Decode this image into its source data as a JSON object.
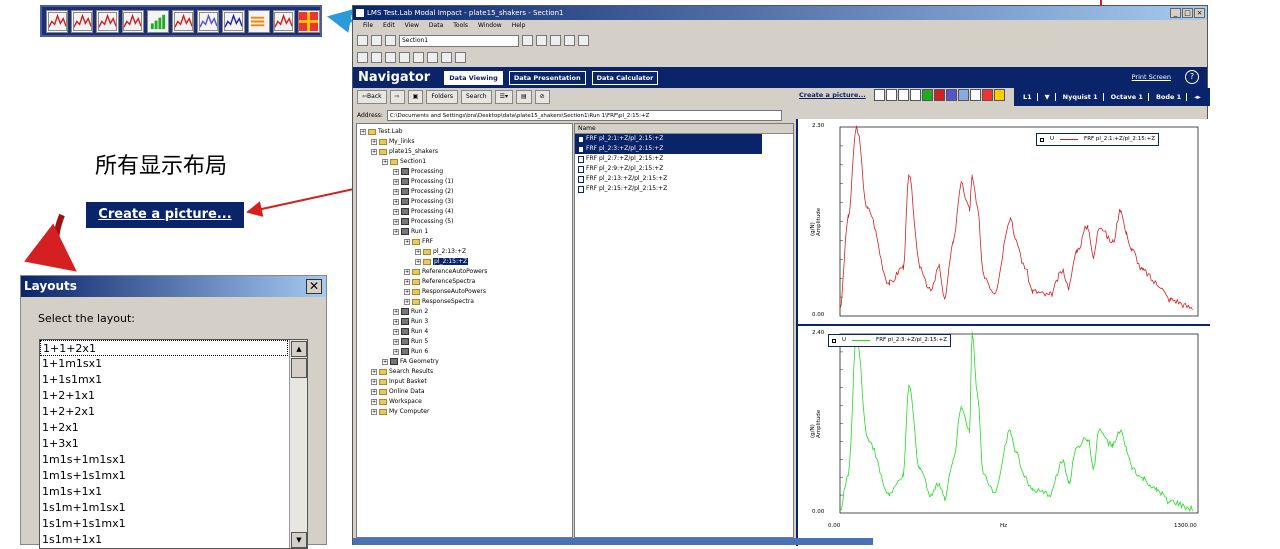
{
  "annotations": {
    "chinese_heading": "所有显示布局",
    "create_picture_big": "Create a picture..."
  },
  "toolbar_icons": [
    "spectrum-icon",
    "frf-icon",
    "overlay-icon",
    "nyquist-icon",
    "bar-icon",
    "waterfall-icon",
    "colormap-icon",
    "wave-icon",
    "arrows-icon",
    "bars-color-icon",
    "cross-icon"
  ],
  "window": {
    "title": "LMS Test.Lab Modal Impact - plate15_shakers - Section1",
    "menus": [
      "File",
      "Edit",
      "View",
      "Data",
      "Tools",
      "Window",
      "Help"
    ],
    "section_value": "Section1",
    "navigator_title": "Navigator",
    "tabs": [
      "Data Viewing",
      "Data Presentation",
      "Data Calculator"
    ],
    "print_screen": "Print Screen",
    "help": "?",
    "back": "Back",
    "folders": "Folders",
    "search": "Search",
    "create_picture": "Create a picture...",
    "view_tabs": [
      "Nyquist 1",
      "Octave 1",
      "Bode 1"
    ],
    "view_current": "L1",
    "address_label": "Address:",
    "address_value": "C:\\Documents and Settings\\bra\\Desktop\\data\\plate15_shakers\\Section1\\Run 1\\FRF\\pl_2:15:+Z"
  },
  "tree": [
    {
      "label": "Test.Lab",
      "indent": 0,
      "icon": "root"
    },
    {
      "label": "My_links",
      "indent": 1,
      "icon": "folder"
    },
    {
      "label": "plate15_shakers",
      "indent": 1,
      "icon": "project"
    },
    {
      "label": "Section1",
      "indent": 2,
      "icon": "folder"
    },
    {
      "label": "Processing",
      "indent": 3,
      "icon": "run"
    },
    {
      "label": "Processing (1)",
      "indent": 3,
      "icon": "run"
    },
    {
      "label": "Processing (2)",
      "indent": 3,
      "icon": "run"
    },
    {
      "label": "Processing (3)",
      "indent": 3,
      "icon": "run"
    },
    {
      "label": "Processing (4)",
      "indent": 3,
      "icon": "run"
    },
    {
      "label": "Processing (5)",
      "indent": 3,
      "icon": "run"
    },
    {
      "label": "Run 1",
      "indent": 3,
      "icon": "run"
    },
    {
      "label": "FRF",
      "indent": 4,
      "icon": "folder"
    },
    {
      "label": "pl_2:13:+Z",
      "indent": 5,
      "icon": "folder"
    },
    {
      "label": "pl_2:15:+Z",
      "indent": 5,
      "icon": "folder",
      "selected": true
    },
    {
      "label": "ReferenceAutoPowers",
      "indent": 4,
      "icon": "folder"
    },
    {
      "label": "ReferenceSpectra",
      "indent": 4,
      "icon": "folder"
    },
    {
      "label": "ResponseAutoPowers",
      "indent": 4,
      "icon": "folder"
    },
    {
      "label": "ResponseSpectra",
      "indent": 4,
      "icon": "folder"
    },
    {
      "label": "Run 2",
      "indent": 3,
      "icon": "run"
    },
    {
      "label": "Run 3",
      "indent": 3,
      "icon": "run"
    },
    {
      "label": "Run 4",
      "indent": 3,
      "icon": "run"
    },
    {
      "label": "Run 5",
      "indent": 3,
      "icon": "run"
    },
    {
      "label": "Run 6",
      "indent": 3,
      "icon": "run"
    },
    {
      "label": "FA Geometry",
      "indent": 2,
      "icon": "run"
    },
    {
      "label": "Search Results",
      "indent": 1,
      "icon": "folder"
    },
    {
      "label": "Input Basket",
      "indent": 1,
      "icon": "folder"
    },
    {
      "label": "Online Data",
      "indent": 1,
      "icon": "folder"
    },
    {
      "label": "Workspace",
      "indent": 1,
      "icon": "folder"
    },
    {
      "label": "My Computer",
      "indent": 1,
      "icon": "folder"
    }
  ],
  "file_list": {
    "header": "Name",
    "items": [
      {
        "label": "FRF pl_2:1:+Z/pl_2:15:+Z",
        "selected": true
      },
      {
        "label": "FRF pl_2:3:+Z/pl_2:15:+Z",
        "selected": true
      },
      {
        "label": "FRF pl_2:7:+Z/pl_2:15:+Z",
        "selected": false
      },
      {
        "label": "FRF pl_2:9:+Z/pl_2:15:+Z",
        "selected": false
      },
      {
        "label": "FRF pl_2:13:+Z/pl_2:15:+Z",
        "selected": false
      },
      {
        "label": "FRF pl_2:15:+Z/pl_2:15:+Z",
        "selected": false
      }
    ]
  },
  "charts": [
    {
      "legend": "FRF pl_2:1:+Z/pl_2:15:+Z",
      "legend_prefix": "U",
      "color": "#d42020",
      "y_top": "2.30",
      "y_bottom": "0.00",
      "ylabel": "Amplitude",
      "yunit": "(g/N)"
    },
    {
      "legend": "FRF pl_2:3:+Z/pl_2:15:+Z",
      "legend_prefix": "U",
      "color": "#22dd22",
      "y_top": "2.40",
      "y_bottom": "0.00",
      "ylabel": "Amplitude",
      "yunit": "(g/N)"
    }
  ],
  "x_axis": {
    "min": "0.00",
    "max": "1300.00",
    "label": "Hz"
  },
  "chart_data": [
    {
      "type": "line",
      "title": "",
      "xlabel": "Hz",
      "ylabel": "Amplitude (g/N)",
      "xlim": [
        0,
        1300
      ],
      "ylim": [
        0,
        2.3
      ],
      "series": [
        {
          "name": "FRF pl_2:1:+Z/pl_2:15:+Z",
          "x": [
            0,
            30,
            60,
            100,
            180,
            230,
            250,
            290,
            330,
            360,
            380,
            410,
            440,
            470,
            480,
            500,
            520,
            560,
            620,
            640,
            670,
            700,
            760,
            810,
            830,
            860,
            900,
            920,
            940,
            990,
            1020,
            1040,
            1060,
            1100,
            1150,
            1200,
            1280
          ],
          "y": [
            0.1,
            1.2,
            2.3,
            1.3,
            0.4,
            0.6,
            1.7,
            0.6,
            0.3,
            0.6,
            0.2,
            0.9,
            1.6,
            1.3,
            1.7,
            1.3,
            0.5,
            0.3,
            1.2,
            0.9,
            0.6,
            0.3,
            0.25,
            0.55,
            0.35,
            0.8,
            1.1,
            0.7,
            1.1,
            0.9,
            1.3,
            1.0,
            0.8,
            0.55,
            0.4,
            0.2,
            0.1
          ]
        }
      ]
    },
    {
      "type": "line",
      "title": "",
      "xlabel": "Hz",
      "ylabel": "Amplitude (g/N)",
      "xlim": [
        0,
        1300
      ],
      "ylim": [
        0,
        2.4
      ],
      "series": [
        {
          "name": "FRF pl_2:3:+Z/pl_2:15:+Z",
          "x": [
            0,
            30,
            60,
            100,
            180,
            230,
            250,
            290,
            330,
            360,
            380,
            410,
            440,
            470,
            480,
            500,
            520,
            560,
            620,
            640,
            670,
            700,
            760,
            810,
            830,
            860,
            900,
            920,
            940,
            990,
            1020,
            1040,
            1060,
            1100,
            1150,
            1200,
            1280
          ],
          "y": [
            0.05,
            0.5,
            2.4,
            1.0,
            0.25,
            0.5,
            1.7,
            0.6,
            0.25,
            0.4,
            0.2,
            0.7,
            1.4,
            1.1,
            2.4,
            1.6,
            0.5,
            0.3,
            1.1,
            0.8,
            0.5,
            0.3,
            0.25,
            0.7,
            0.4,
            0.9,
            1.0,
            0.6,
            1.1,
            0.9,
            1.1,
            0.85,
            0.6,
            0.45,
            0.3,
            0.15,
            0.05
          ]
        }
      ]
    }
  ],
  "layouts_dialog": {
    "title": "Layouts",
    "close": "✕",
    "prompt": "Select the layout:",
    "items": [
      "1+1+2x1",
      "1+1m1sx1",
      "1+1s1mx1",
      "1+2+1x1",
      "1+2+2x1",
      "1+2x1",
      "1+3x1",
      "1m1s+1m1sx1",
      "1m1s+1s1mx1",
      "1m1s+1x1",
      "1s1m+1m1sx1",
      "1s1m+1s1mx1",
      "1s1m+1x1"
    ]
  },
  "colors": {
    "navy": "#0a246a",
    "annotation_red": "#d42020",
    "arrow_cyan": "#2a9ad8",
    "arrow_gray": "#999999"
  }
}
